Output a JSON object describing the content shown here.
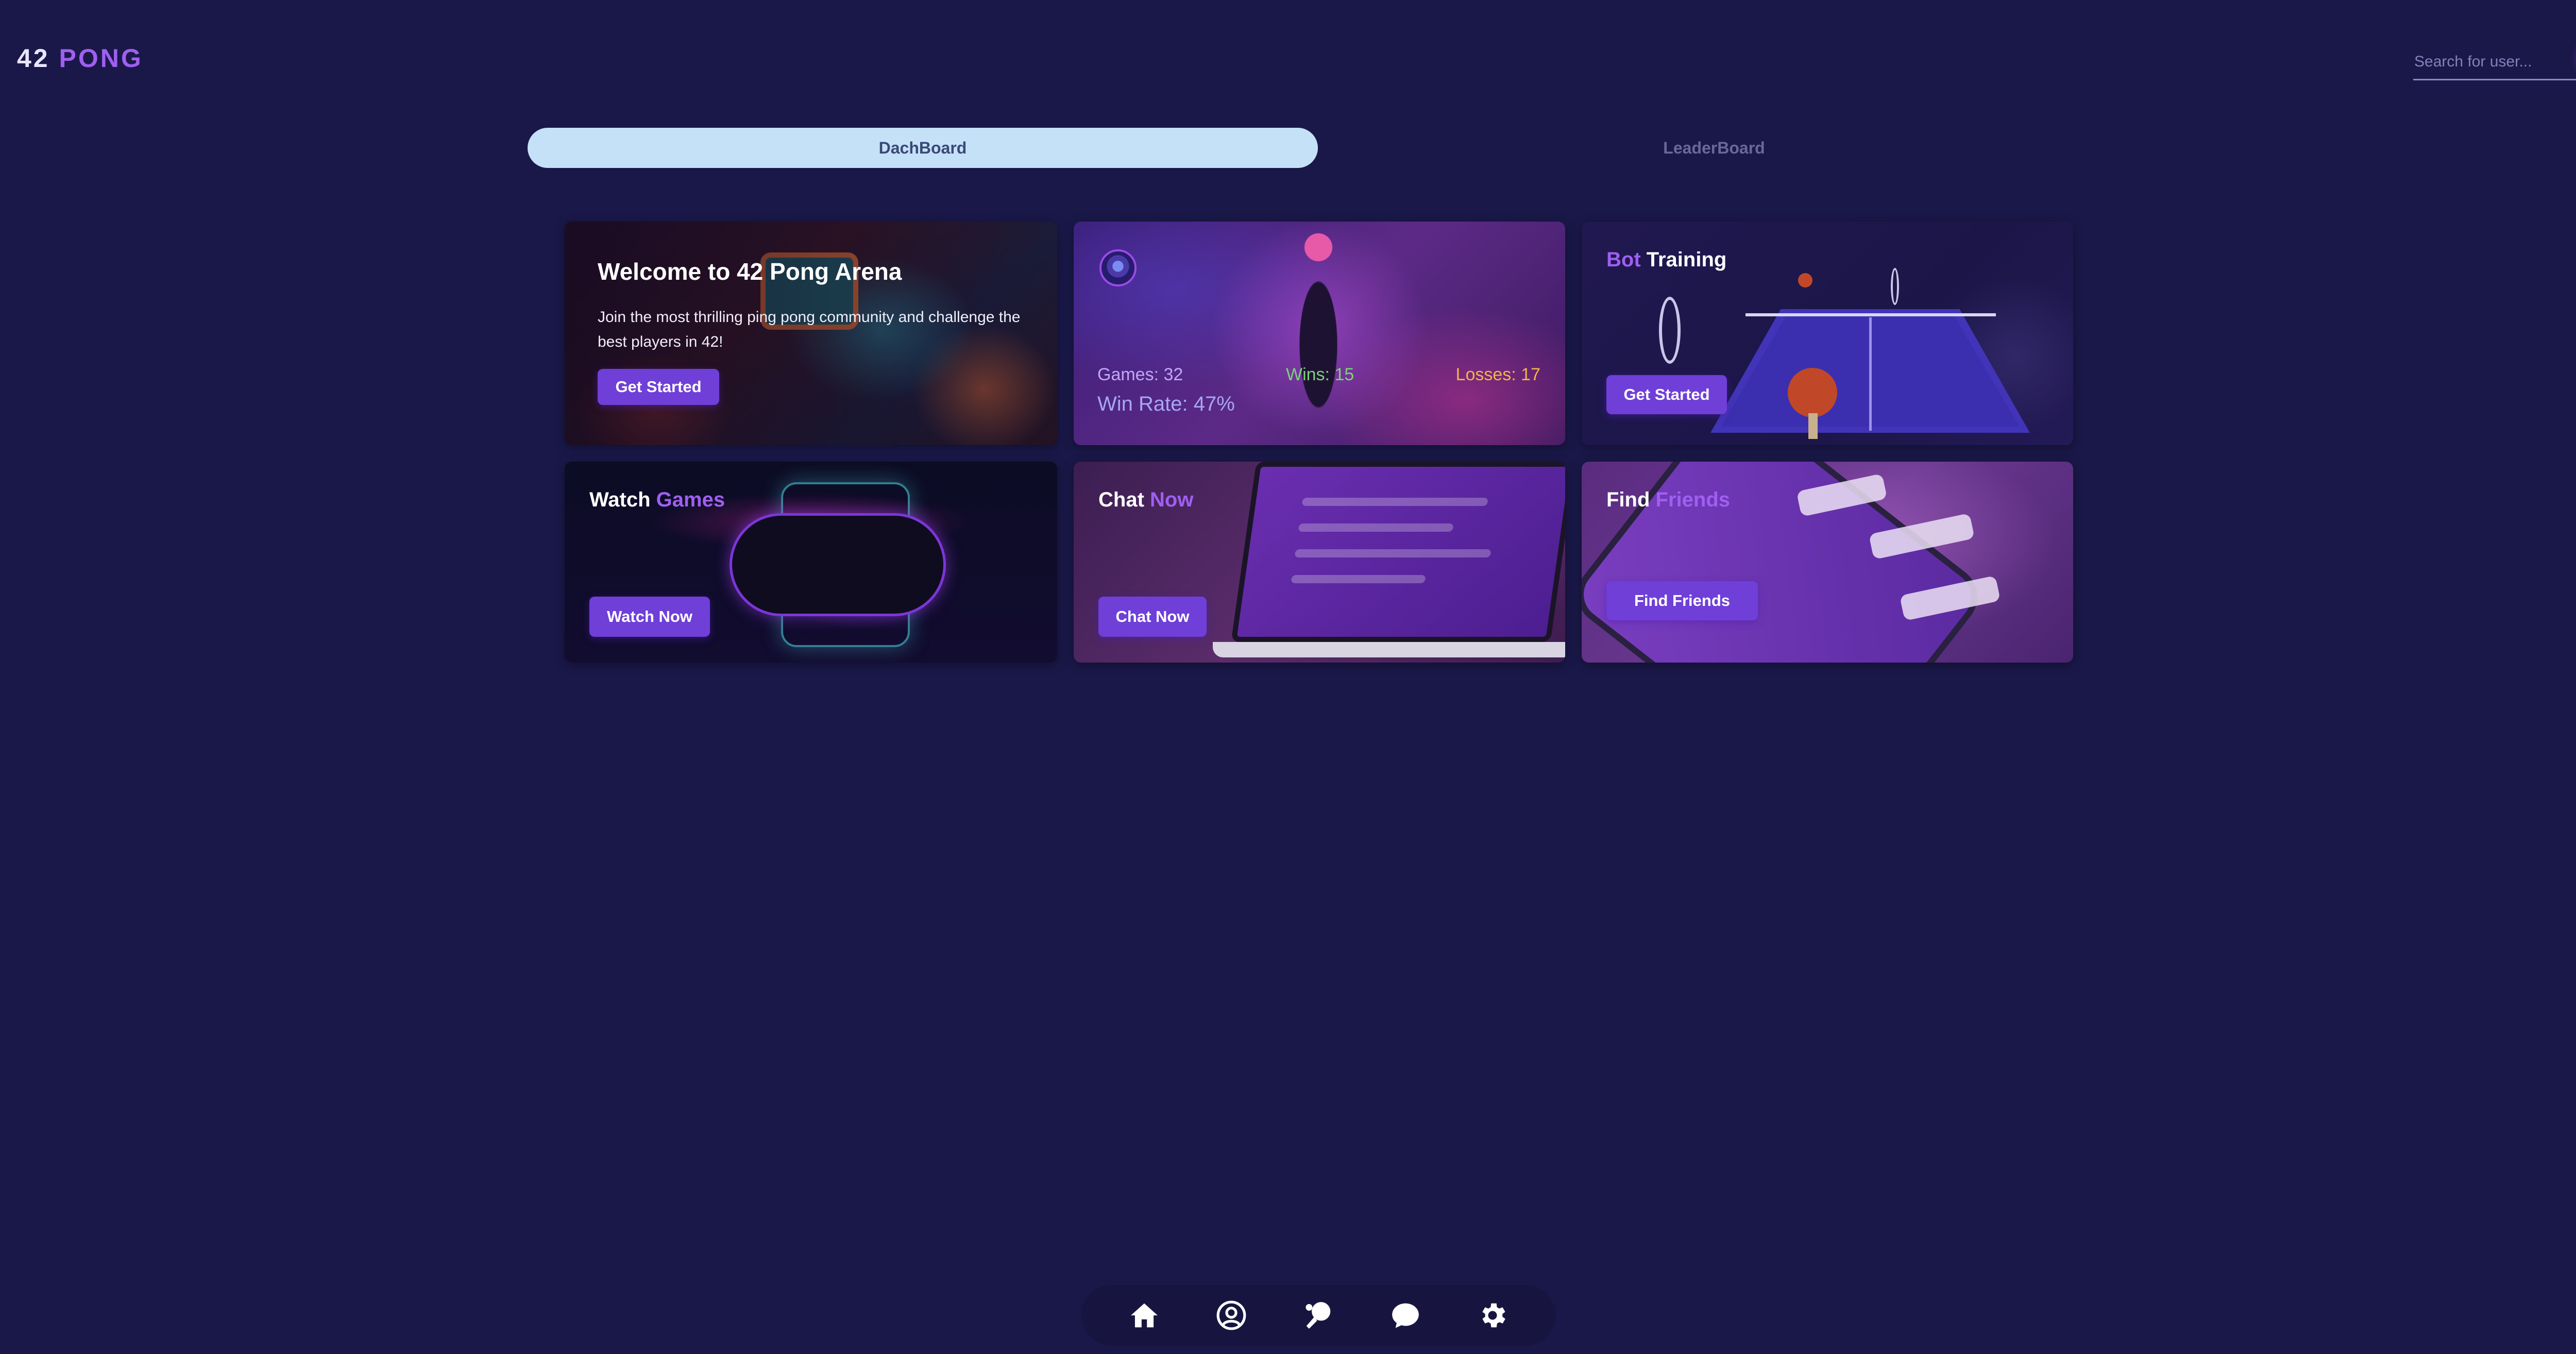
{
  "header": {
    "logo_number": "42",
    "logo_word": "PONG",
    "search_placeholder": "Search for user..."
  },
  "tabs": [
    {
      "label": "DachBoard",
      "active": true
    },
    {
      "label": "LeaderBoard",
      "active": false
    }
  ],
  "welcome": {
    "title": "Welcome to 42 Pong Arena",
    "text": "Join the most thrilling ping pong community and challenge the best players in 42!",
    "button": "Get Started"
  },
  "stats": {
    "games": "Games: 32",
    "wins": "Wins: 15",
    "losses": "Losses: 17",
    "win_rate": "Win Rate: 47%"
  },
  "bot": {
    "title_accent": "Bot",
    "title_rest": "Training",
    "button": "Get Started"
  },
  "watch": {
    "title_rest": "Watch",
    "title_accent": "Games",
    "button": "Watch Now"
  },
  "chat": {
    "title_rest": "Chat",
    "title_accent": "Now",
    "button": "Chat Now"
  },
  "friends": {
    "title_rest": "Find",
    "title_accent": "Friends",
    "button": "Find Friends"
  },
  "nav": {
    "icons": [
      "home-icon",
      "profile-icon",
      "ping-pong-icon",
      "chat-icon",
      "settings-icon"
    ]
  },
  "colors": {
    "background": "#1a1848",
    "accent": "#9f5ff0",
    "button": "#6f3fd8",
    "active_tab": "#c5e1f8",
    "wins": "#7bd17a",
    "losses": "#f0b44a"
  }
}
